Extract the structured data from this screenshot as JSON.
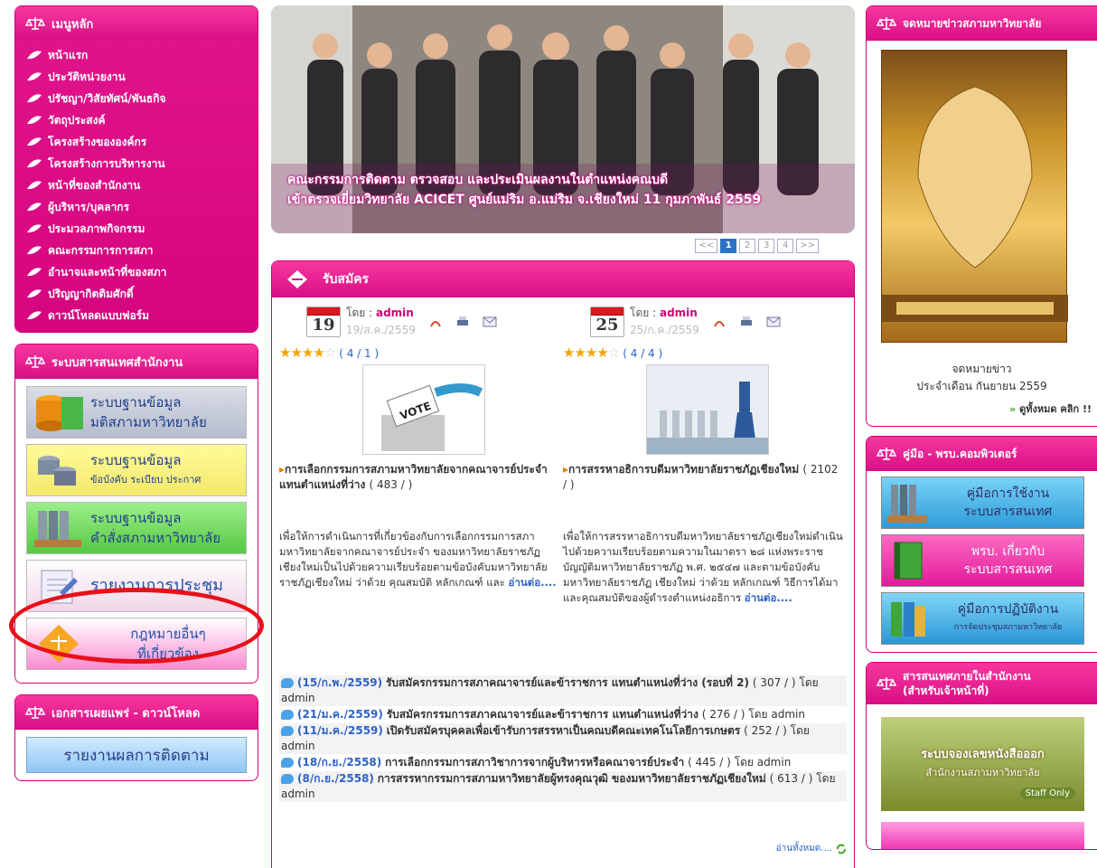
{
  "left_menu": {
    "title": "เมนูหลัก",
    "items": [
      "หน้าแรก",
      "ประวัติหน่วยงาน",
      "ปรัชญา/วิสัยทัศน์/พันธกิจ",
      "วัตถุประสงค์",
      "โครงสร้างขององค์กร",
      "โครงสร้างการบริหารงาน",
      "หน้าที่ของสำนักงาน",
      "ผู้บริหาร/บุคลากร",
      "ประมวลภาพกิจกรรม",
      "คณะกรรมการการสภา",
      "อำนาจและหน้าที่ของสภา",
      "ปริญญากิตติมศักดิ์",
      "ดาวน์โหลดแบบฟอร์ม"
    ]
  },
  "info_system": {
    "title": "ระบบสารสนเทศสำนักงาน",
    "banners": [
      {
        "line1": "ระบบฐานข้อมูล",
        "line2": "มติสภามหาวิทยาลัย"
      },
      {
        "line1": "ระบบฐานข้อมูล",
        "line2": "ข้อบังคับ ระเบียบ ประกาศ"
      },
      {
        "line1": "ระบบฐานข้อมูล",
        "line2": "คำสั่งสภามหาวิทยาลัย"
      },
      {
        "line1": "รายงานการประชุม",
        "line2": ""
      },
      {
        "line1": "กฎหมายอื่นๆ",
        "line2": "ที่เกี่ยวข้อง"
      }
    ]
  },
  "documents": {
    "title": "เอกสารเผยแพร่ - ดาวน์โหลด",
    "banner": "รายงานผลการติดตาม"
  },
  "slider": {
    "caption_line1": "คณะกรรมการติดตาม ตรวจสอบ และประเมินผลงานในตำแหน่งคณบดี",
    "caption_line2": "เข้าตรวจเยี่ยมวิทยาลัย ACICET ศูนย์แม่ริม อ.แม่ริม จ.เชียงใหม่ 11 กุมภาพันธ์ 2559",
    "pager": [
      "<<",
      "1",
      "2",
      "3",
      "4",
      ">>"
    ]
  },
  "news": {
    "title": "รับสมัคร",
    "entries": [
      {
        "day": "19",
        "by_label": "โดย :",
        "author": "admin",
        "date": "19/ส.ค./2559",
        "rating": "( 4 / 1 )",
        "title": "การเลือกกรรมการสภามหาวิทยาลัยจากคณาจารย์ประจำ แทนตำแหน่งที่ว่าง",
        "count": "( 483 / )",
        "text": "เพื่อให้การดำเนินการที่เกี่ยวข้องกับการเลือกกรรมการสภามหาวิทยาลัยจากคณาจารย์ประจำ ของมหาวิทยาลัยราชภัฏเชียงใหม่เป็นไปด้วยความเรียบร้อยตามข้อบังคับมหาวิทยาลัยราชภัฏเชียงใหม่ ว่าด้วย คุณสมบัติ หลักเกณฑ์ และ",
        "readmore": "อ่านต่อ...."
      },
      {
        "day": "25",
        "by_label": "โดย :",
        "author": "admin",
        "date": "25/ก.ค./2559",
        "rating": "( 4 / 4 )",
        "title": "การสรรหาอธิการบดีมหาวิทยาลัยราชภัฏเชียงใหม่",
        "count": "( 2102 / )",
        "text": "เพื่อให้การสรรหาอธิการบดีมหาวิทยาลัยราชภัฏเชียงใหม่ดำเนินไปด้วยความเรียบร้อยตามความในมาตรา ๒๘ แห่งพระราชบัญญัติมหาวิทยาลัยราชภัฏ พ.ศ. ๒๕๔๗ และตามข้อบังคับมหาวิทยาลัยราชภัฏ เชียงใหม่ ว่าด้วย หลักเกณฑ์ วิธีการได้มา และคุณสมบัติของผู้ดำรงตำแหน่งอธิการ",
        "readmore": "อ่านต่อ...."
      }
    ],
    "list": [
      {
        "date": "(15/ก.พ./2559)",
        "title": "รับสมัครกรรมการสภาคณาจารย์และข้าราชการ แทนตำแหน่งที่ว่าง (รอบที่ 2)",
        "meta": "( 307 / ) โดย admin"
      },
      {
        "date": "(21/ม.ค./2559)",
        "title": "รับสมัครกรรมการสภาคณาจารย์และข้าราชการ แทนตำแหน่งที่ว่าง",
        "meta": "( 276 / ) โดย admin"
      },
      {
        "date": "(11/ม.ค./2559)",
        "title": "เปิดรับสมัครบุคคลเพื่อเข้ารับการสรรหาเป็นคณบดีคณะเทคโนโลยีการเกษตร",
        "meta": "( 252 / ) โดย admin"
      },
      {
        "date": "(18/ก.ย./2558)",
        "title": "การเลือกกรรมการสภาวิชาการจากผู้บริหารหรือคณาจารย์ประจำ",
        "meta": "( 445 / ) โดย admin"
      },
      {
        "date": "(8/ก.ย./2558)",
        "title": "การสรรหากรรมการสภามหาวิทยาลัยผู้ทรงคุณวุฒิ ของมหาวิทยาลัยราชภัฏเชียงใหม่",
        "meta": "( 613 / ) โดย admin"
      }
    ],
    "more": "อ่านทั้งหมด...."
  },
  "right": {
    "newsletter_title": "จดหมายข่าวสภามหาวิทยาลัย",
    "newsletter_caption1": "จดหมายข่าว",
    "newsletter_caption2": "ประจำเดือน กันยายน 2559",
    "see_all": "ดูทั้งหมด คลิก !!",
    "manual_title": "คู่มือ - พรบ.คอมพิวเตอร์",
    "manuals": [
      {
        "line1": "คู่มือการใช้งาน",
        "line2": "ระบบสารสนเทศ"
      },
      {
        "line1": "พรบ. เกี่ยวกับ",
        "line2": "ระบบสารสนเทศ"
      },
      {
        "line1": "คู่มือการปฏิบัติงาน",
        "line2": "การจัดประชุมสภามหาวิทยาลัย"
      }
    ],
    "internal_title1": "สารสนเทศภายในสำนักงาน",
    "internal_title2": "(สำหรับเจ้าหน้าที่)",
    "staff_title": "ระบบจองเลขหนังสือออก",
    "staff_sub": "สำนักงานสภามหาวิทยาลัย",
    "staff_only": "Staff Only"
  }
}
